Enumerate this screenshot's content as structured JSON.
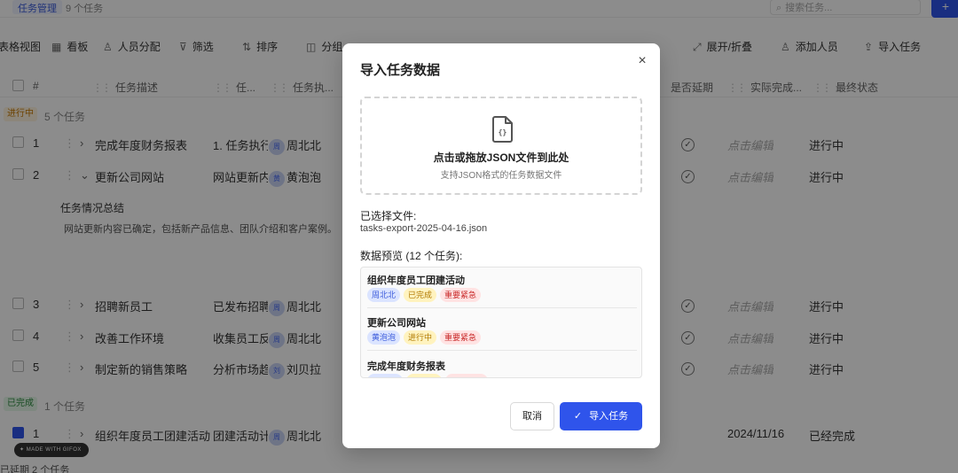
{
  "topbar": {
    "tab": "任务管理",
    "count": "9 个任务",
    "search_placeholder": "搜索任务...",
    "add_label": "+"
  },
  "toolbar": [
    {
      "label": "表格视图",
      "icon": "none"
    },
    {
      "label": "看板",
      "icon": "grid-icon"
    },
    {
      "label": "人员分配",
      "icon": "user-icon"
    },
    {
      "label": "筛选",
      "icon": "filter-icon"
    },
    {
      "label": "排序",
      "icon": "sort-icon"
    },
    {
      "label": "分组",
      "icon": "columns-icon"
    },
    {
      "label": "展开/折叠",
      "icon": "expand-icon"
    },
    {
      "label": "添加人员",
      "icon": "user-icon"
    },
    {
      "label": "导入任务",
      "icon": "upload-icon"
    }
  ],
  "table": {
    "headers": [
      "#",
      "任务描述",
      "任...",
      "任务执...",
      "是否延期",
      "实际完成...",
      "最终状态"
    ],
    "groups": [
      {
        "label": "进行中",
        "count": "5 个任务"
      },
      {
        "label": "已完成",
        "count": "1 个任务"
      }
    ],
    "rows": [
      {
        "num": "1",
        "name": "完成年度财务报表",
        "sub": "1. 任务执行",
        "assignee": "周北北",
        "actual": "点击编辑",
        "status": "进行中"
      },
      {
        "num": "2",
        "name": "更新公司网站",
        "sub": "网站更新内",
        "assignee": "黄泡泡",
        "actual": "点击编辑",
        "status": "进行中"
      },
      {
        "num": "3",
        "name": "招聘新员工",
        "sub": "已发布招聘",
        "assignee": "周北北",
        "actual": "点击编辑",
        "status": "进行中"
      },
      {
        "num": "4",
        "name": "改善工作环境",
        "sub": "收集员工反",
        "assignee": "周北北",
        "actual": "点击编辑",
        "status": "进行中"
      },
      {
        "num": "5",
        "name": "制定新的销售策略",
        "sub": "分析市场趋",
        "assignee": "刘贝拉",
        "actual": "点击编辑",
        "status": "进行中"
      },
      {
        "num": "1",
        "name": "组织年度员工团建活动",
        "sub": "团建活动计",
        "assignee": "周北北",
        "actual": "2024/11/16",
        "status": "已经完成"
      }
    ],
    "summary_title": "任务情况总结",
    "summary_text": "网站更新内容已确定，包括新产品信息、团队介绍和客户案例。"
  },
  "made_with": "MADE WITH GIFOX",
  "bottom_badge": "已延期   2 个任务",
  "modal": {
    "title": "导入任务数据",
    "dropzone_title": "点击或拖放JSON文件到此处",
    "dropzone_sub": "支持JSON格式的任务数据文件",
    "selected_label": "已选择文件:",
    "selected_file": "tasks-export-2025-04-16.json",
    "preview_label": "数据预览 (12 个任务):",
    "preview_items": [
      {
        "name": "组织年度员工团建活动",
        "tags": [
          {
            "text": "周北北",
            "color": "blue"
          },
          {
            "text": "已完成",
            "color": "yellow"
          },
          {
            "text": "重要紧急",
            "color": "red"
          }
        ]
      },
      {
        "name": "更新公司网站",
        "tags": [
          {
            "text": "黄泡泡",
            "color": "blue"
          },
          {
            "text": "进行中",
            "color": "yellow"
          },
          {
            "text": "重要紧急",
            "color": "red"
          }
        ]
      },
      {
        "name": "完成年度财务报表",
        "tags": [
          {
            "text": "",
            "color": "blue"
          },
          {
            "text": "",
            "color": "yellow"
          },
          {
            "text": "",
            "color": "red"
          }
        ]
      }
    ],
    "cancel_label": "取消",
    "import_label": "导入任务"
  },
  "colors": {
    "primary": "#2f54eb",
    "overlay": "rgba(0,0,0,0.45)"
  }
}
